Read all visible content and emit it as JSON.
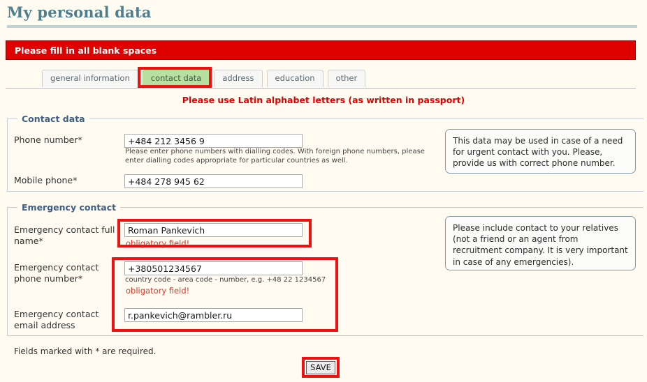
{
  "page": {
    "title": "My personal data",
    "alert": "Please fill in all blank spaces",
    "latin_notice": "Please use Latin alphabet letters (as written in passport)",
    "required_note": "Fields marked with * are required.",
    "save_label": "SAVE",
    "accent_red": "#e00000",
    "title_color": "#4d7f8f",
    "active_tab_color": "#b8e0a0",
    "annotation_color": "#ee1111"
  },
  "tabs": [
    {
      "label": "general information",
      "active": false
    },
    {
      "label": "contact data",
      "active": true
    },
    {
      "label": "address",
      "active": false
    },
    {
      "label": "education",
      "active": false
    },
    {
      "label": "other",
      "active": false
    }
  ],
  "contact_section": {
    "legend": "Contact data",
    "phone": {
      "label": "Phone number*",
      "value": "+484 212 3456 9",
      "hint": "Please enter phone numbers with dialling codes. With foreign phone numbers, please enter dialling codes appropriate for particular countries as well."
    },
    "mobile": {
      "label": "Mobile phone*",
      "value": "+484 278 945 62"
    },
    "callout": "This data may be used in case of a need for urgent contact with you. Please, provide us with correct phone number."
  },
  "emergency_section": {
    "legend": "Emergency contact",
    "full_name": {
      "label": "Emergency contact full name*",
      "value": "Roman Pankevich",
      "error": "obligatory field!"
    },
    "phone": {
      "label": "Emergency contact phone number*",
      "value": "+380501234567",
      "hint": "country code - area code - number, e.g. +48 22 1234567",
      "error": "obligatory field!"
    },
    "email": {
      "label": "Emergency contact email address",
      "value": "r.pankevich@rambler.ru"
    },
    "callout": "Please include contact to your relatives (not a friend or an agent from recruitment company. It is very important in case of any emergencies)."
  }
}
